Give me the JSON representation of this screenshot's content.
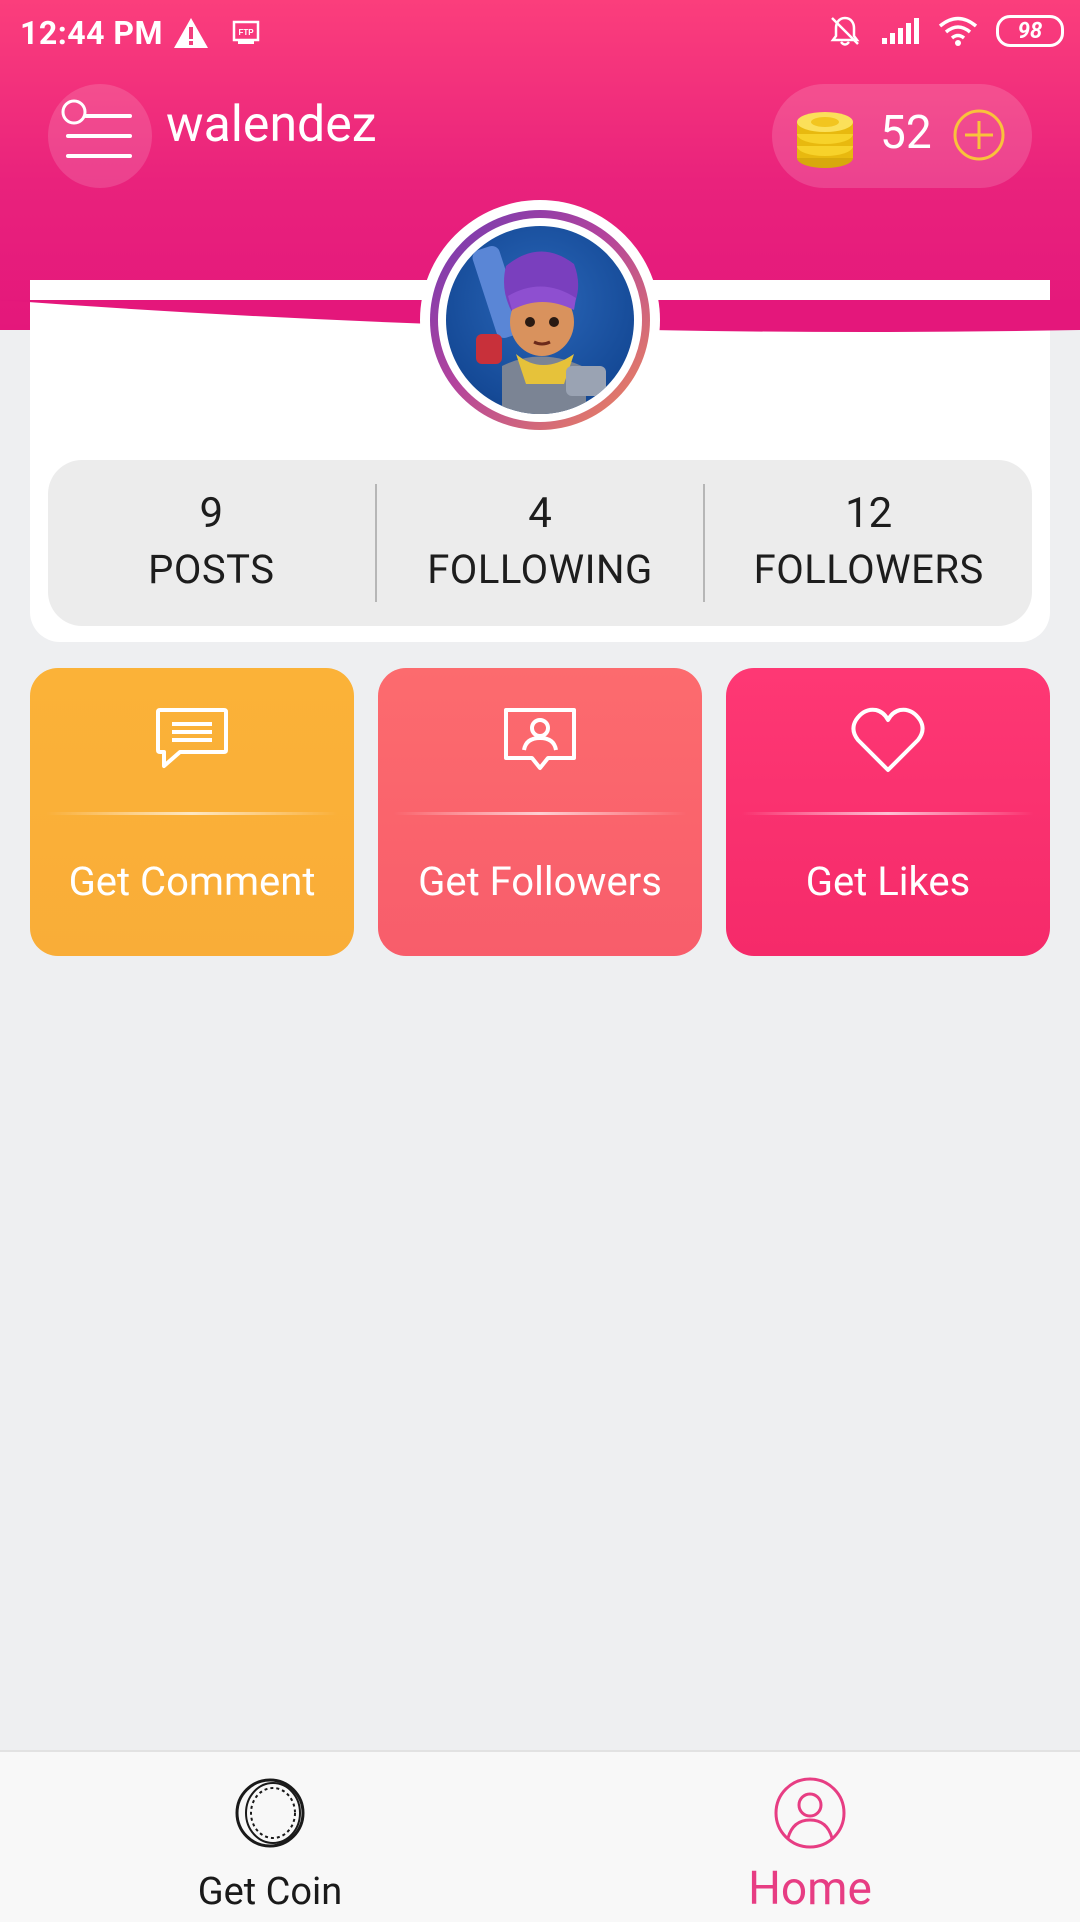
{
  "status_bar": {
    "time": "12:44 PM",
    "battery": "98",
    "icons": [
      "warning-icon",
      "ftp-icon",
      "notifications-off-icon",
      "signal-icon",
      "wifi-icon",
      "battery-icon"
    ]
  },
  "header": {
    "username": "walendez",
    "coins": "52"
  },
  "stats": [
    {
      "value": "9",
      "label": "POSTS"
    },
    {
      "value": "4",
      "label": "FOLLOWING"
    },
    {
      "value": "12",
      "label": "FOLLOWERS"
    }
  ],
  "actions": [
    {
      "label": "Get Comment",
      "icon": "comment-icon",
      "color": "#f9ad38"
    },
    {
      "label": "Get Followers",
      "icon": "profile-frame-icon",
      "color": "#f85d6b"
    },
    {
      "label": "Get Likes",
      "icon": "heart-icon",
      "color": "#f52a6a"
    }
  ],
  "bottom_nav": {
    "items": [
      {
        "label": "Get Coin",
        "icon": "coin-icon",
        "active": false
      },
      {
        "label": "Home",
        "icon": "user-icon",
        "active": true
      }
    ]
  },
  "colors": {
    "header_top": "#fb3e7c",
    "header_bottom": "#e4177b",
    "active_nav": "#e73d83",
    "background": "#eeeff1"
  }
}
